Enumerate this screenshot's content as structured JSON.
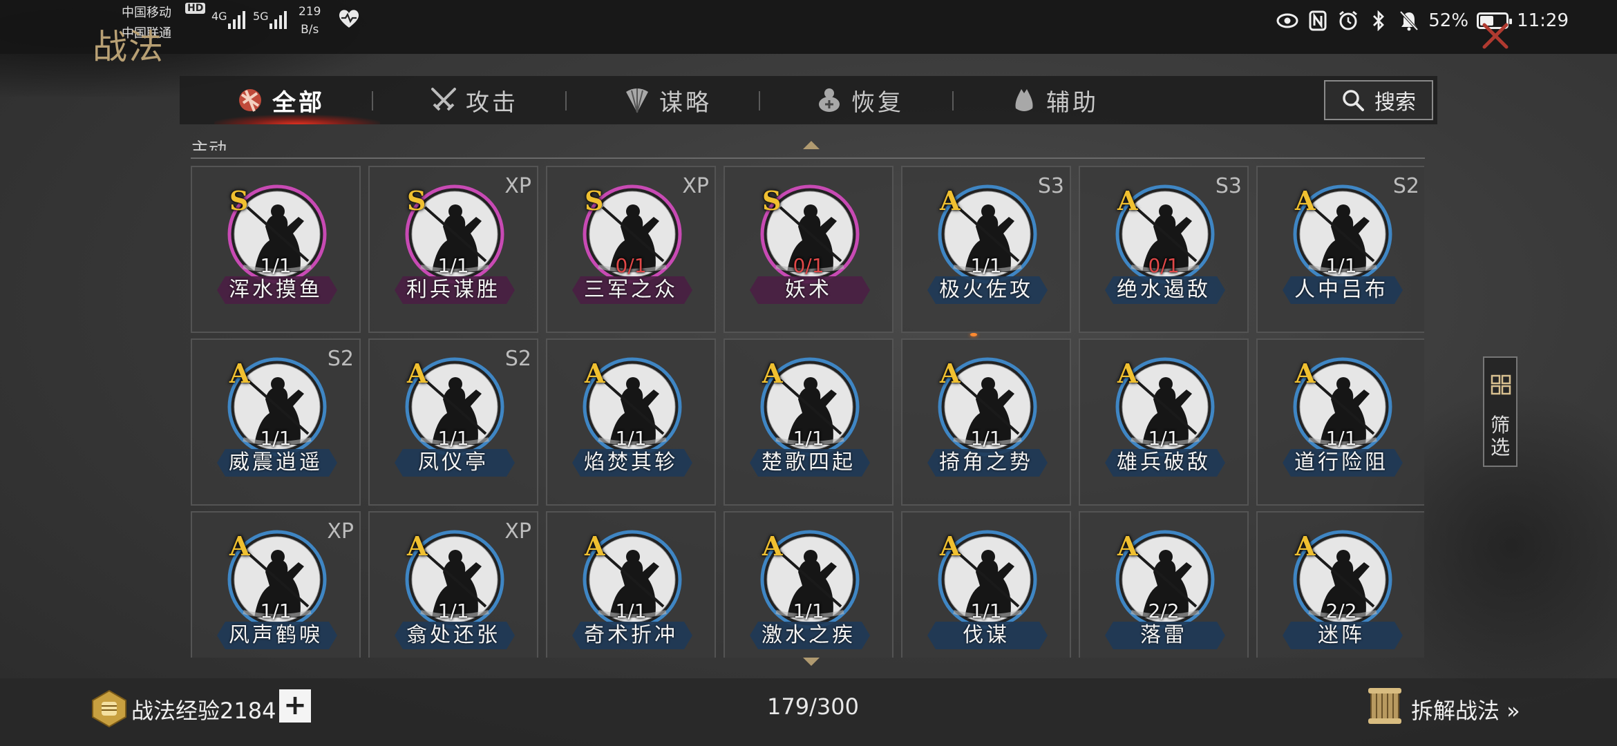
{
  "status_bar": {
    "carrier1": "中国移动",
    "carrier2": "中国联通",
    "hd": "HD",
    "net1": "4G",
    "net2": "5G",
    "speed_value": "219",
    "speed_unit": "B/s",
    "battery_percent": "52%",
    "battery_level": 0.52,
    "time": "11:29"
  },
  "page_title": "战法",
  "tabs": [
    {
      "label": "全部",
      "icon": "all-scrolls-icon",
      "active": true
    },
    {
      "label": "攻击",
      "icon": "crossed-swords-icon",
      "active": false
    },
    {
      "label": "谋略",
      "icon": "feather-fan-icon",
      "active": false
    },
    {
      "label": "恢复",
      "icon": "medicine-gourd-icon",
      "active": false
    },
    {
      "label": "辅助",
      "icon": "pouch-icon",
      "active": false
    }
  ],
  "search_label": "搜索",
  "section_label": "主动",
  "skills": [
    {
      "name": "浑水摸鱼",
      "grade": "S",
      "count": "1/1",
      "tag": ""
    },
    {
      "name": "利兵谋胜",
      "grade": "S",
      "count": "1/1",
      "tag": "XP"
    },
    {
      "name": "三军之众",
      "grade": "S",
      "count": "0/1",
      "tag": "XP"
    },
    {
      "name": "妖术",
      "grade": "S",
      "count": "0/1",
      "tag": ""
    },
    {
      "name": "极火佐攻",
      "grade": "A",
      "count": "1/1",
      "tag": "S3"
    },
    {
      "name": "绝水遏敌",
      "grade": "A",
      "count": "0/1",
      "tag": "S3"
    },
    {
      "name": "人中吕布",
      "grade": "A",
      "count": "1/1",
      "tag": "S2"
    },
    {
      "name": "威震逍遥",
      "grade": "A",
      "count": "1/1",
      "tag": "S2"
    },
    {
      "name": "凤仪亭",
      "grade": "A",
      "count": "1/1",
      "tag": "S2"
    },
    {
      "name": "焰焚其轸",
      "grade": "A",
      "count": "1/1",
      "tag": ""
    },
    {
      "name": "楚歌四起",
      "grade": "A",
      "count": "1/1",
      "tag": ""
    },
    {
      "name": "掎角之势",
      "grade": "A",
      "count": "1/1",
      "tag": ""
    },
    {
      "name": "雄兵破敌",
      "grade": "A",
      "count": "1/1",
      "tag": ""
    },
    {
      "name": "道行险阻",
      "grade": "A",
      "count": "1/1",
      "tag": ""
    },
    {
      "name": "风声鹤唳",
      "grade": "A",
      "count": "1/1",
      "tag": "XP"
    },
    {
      "name": "翕处还张",
      "grade": "A",
      "count": "1/1",
      "tag": "XP"
    },
    {
      "name": "奇术折冲",
      "grade": "A",
      "count": "1/1",
      "tag": ""
    },
    {
      "name": "激水之疾",
      "grade": "A",
      "count": "1/1",
      "tag": ""
    },
    {
      "name": "伐谋",
      "grade": "A",
      "count": "1/1",
      "tag": ""
    },
    {
      "name": "落雷",
      "grade": "A",
      "count": "2/2",
      "tag": ""
    },
    {
      "name": "迷阵",
      "grade": "A",
      "count": "2/2",
      "tag": ""
    }
  ],
  "filter_label": "筛选",
  "bottom": {
    "exp_label": "战法经验2184",
    "plus": "+",
    "capacity": "179/300",
    "dismantle_label": "拆解战法 »"
  },
  "colors": {
    "grade_s_ring": "#c84ab4",
    "grade_a_ring": "#3f86c4",
    "grade_letter": "#f0c030",
    "count_zero": "#e04848",
    "plate_s": "#4a1f44",
    "plate_a": "#1f3a58"
  }
}
